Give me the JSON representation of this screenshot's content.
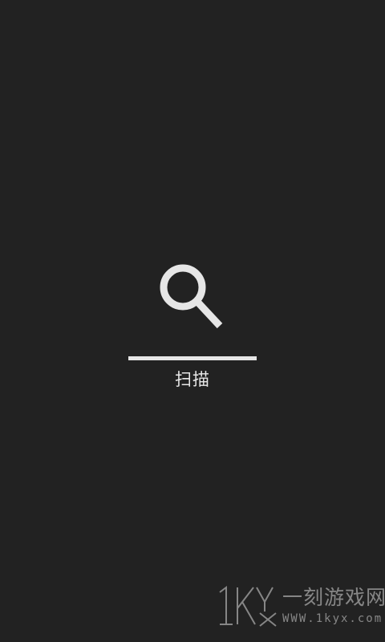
{
  "scan": {
    "icon": "search-icon",
    "label": "扫描",
    "progress": 1.0
  },
  "watermark": {
    "logo": "1Kyx",
    "text": "一刻游戏网",
    "url": "WWW.1kyx.com"
  },
  "colors": {
    "background": "#222222",
    "foreground": "#e6e6e6"
  }
}
